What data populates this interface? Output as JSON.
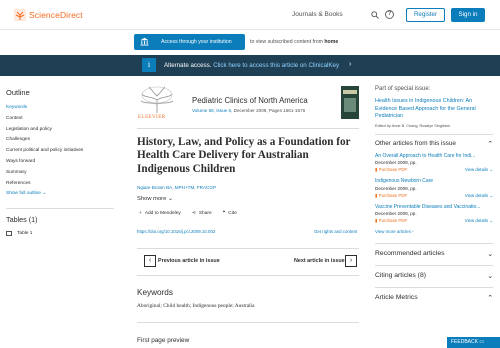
{
  "header": {
    "brand": "ScienceDirect",
    "nav_journals": "Journals & Books",
    "register_label": "Register",
    "signin_label": "Sign in",
    "help_glyph": "?"
  },
  "access": {
    "button_label": "Access through your institution",
    "text_prefix": "to view subscribed content from ",
    "text_bold": "home"
  },
  "alt_access": {
    "icon_glyph": "i",
    "label": "Alternate access.",
    "link": "Click here to access this article on ClinicalKey",
    "arrow": "›"
  },
  "outline": {
    "title": "Outline",
    "items": [
      "Keywords",
      "Context",
      "Legislation and policy",
      "Challenges",
      "Current political and policy initiatives",
      "Ways forward",
      "Summary",
      "References"
    ],
    "show_more": "Show full outline",
    "tables_title": "Tables (1)",
    "table_item": "Table 1"
  },
  "journal": {
    "publisher": "ELSEVIER",
    "title": "Pediatric Clinics of North America",
    "volume_link": "Volume 56, Issue 6,",
    "info": " December 2009, Pages 1561-1576"
  },
  "article": {
    "title": "History, Law, and Policy as a Foundation for Health Care Delivery for Australian Indigenous Children",
    "authors": "Ngiare Brown BA, MPH+TM, FRACGP",
    "show_more": "Show more",
    "actions": [
      "Add to Mendeley",
      "Share",
      "Cite"
    ],
    "doi": "https://doi.org/10.1016/j.pcl.2009.10.002",
    "rights": "Get rights and content",
    "prev_label": "Previous article in issue",
    "next_label": "Next article in issue",
    "keywords_title": "Keywords",
    "keywords": "Aboriginal; Child health; Indigenous people; Australia",
    "first_page": "First page preview"
  },
  "sidebar": {
    "part_of": "Part of special issue:",
    "issue_title": "Health Issues in Indigenous Children: An Evidence Based Approach for the General Pediatrician",
    "editors": "Edited by Anne B. Chang, Rosalyn Singleton",
    "other_articles": "Other articles from this issue",
    "articles": [
      {
        "title": "An Overall Approach to Health Care for Indi...",
        "date": "December 2009, pp.",
        "pdf": "Purchase PDF",
        "view": "View details"
      },
      {
        "title": "Indigenous Newborn Care",
        "date": "December 2009, pp.",
        "pdf": "Purchase PDF",
        "view": "View details"
      },
      {
        "title": "Vaccine Preventable Diseases and Vaccinatio...",
        "date": "December 2009, pp.",
        "pdf": "Purchase PDF",
        "view": "View details"
      }
    ],
    "view_more": "View more articles",
    "recommended": "Recommended articles",
    "citing": "Citing articles (8)",
    "metrics": "Article Metrics"
  },
  "feedback": "FEEDBACK",
  "colors": {
    "accent": "#0c7dbb",
    "brand": "#f36d21",
    "banner": "#1f3f55"
  }
}
